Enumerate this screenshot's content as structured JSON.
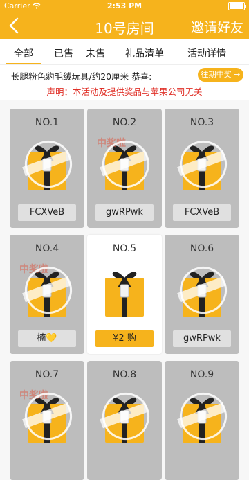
{
  "status_bar": {
    "carrier": "Carrier",
    "time": "2:53 PM"
  },
  "nav": {
    "back_icon": "chevron-left-icon",
    "title": "10号房间",
    "invite_label": "邀请好友"
  },
  "tabs": [
    {
      "label": "全部",
      "active": true
    },
    {
      "label": "已售",
      "active": false
    },
    {
      "label": "未售",
      "active": false
    },
    {
      "label": "礼品清单",
      "active": false
    },
    {
      "label": "活动详情",
      "active": false
    }
  ],
  "ticker": {
    "text": "长腿粉色豹毛绒玩具/约20厘米  恭喜: ",
    "button_label": "往期中奖 →"
  },
  "disclaimer": "声明：本活动及提供奖品与苹果公司无关",
  "cards": [
    {
      "number": "NO.1",
      "label": "FCXVeB",
      "sold": true,
      "watermark": false
    },
    {
      "number": "NO.2",
      "label": "gwRPwk",
      "sold": true,
      "watermark": true
    },
    {
      "number": "NO.3",
      "label": "FCXVeB",
      "sold": true,
      "watermark": false
    },
    {
      "number": "NO.4",
      "label": "楠💛",
      "sold": true,
      "watermark": true
    },
    {
      "number": "NO.5",
      "label": "¥2 购",
      "sold": false,
      "watermark": false
    },
    {
      "number": "NO.6",
      "label": "gwRPwk",
      "sold": true,
      "watermark": false
    },
    {
      "number": "NO.7",
      "label": "",
      "sold": true,
      "watermark": true
    },
    {
      "number": "NO.8",
      "label": "",
      "sold": true,
      "watermark": false
    },
    {
      "number": "NO.9",
      "label": "",
      "sold": true,
      "watermark": false
    }
  ],
  "watermark_text": "中奖啦",
  "colors": {
    "brand": "#f6b31c",
    "warning": "#e0322a",
    "sold_card": "#bdbdbd"
  }
}
